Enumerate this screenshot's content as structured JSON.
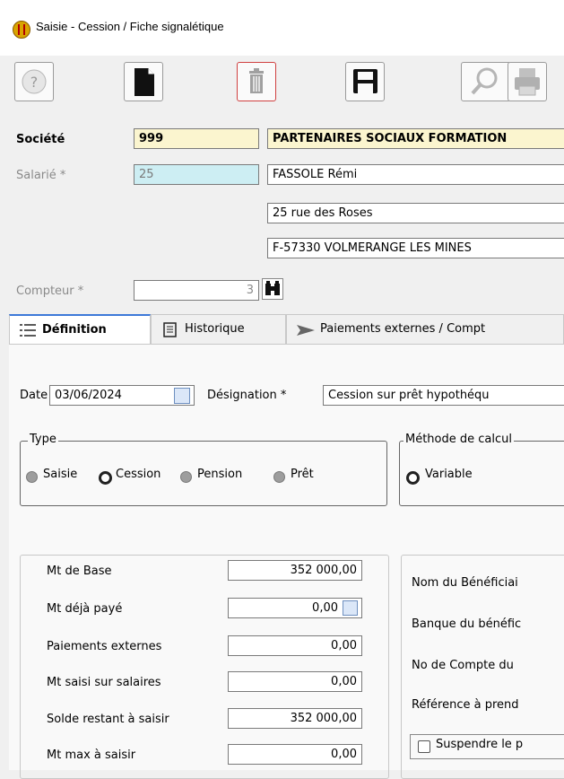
{
  "window": {
    "title": "Saisie - Cession / Fiche signalétique"
  },
  "header": {
    "societe_label": "Société",
    "societe_code": "999",
    "societe_name": "PARTENAIRES SOCIAUX FORMATION",
    "salarie_label": "Salarié *",
    "salarie_code": "25",
    "salarie_name": "FASSOLE Rémi",
    "address1": "25 rue des Roses",
    "address2": "F-57330 VOLMERANGE LES MINES",
    "compteur_label": "Compteur *",
    "compteur_value": "3"
  },
  "tabs": [
    {
      "label": "Définition"
    },
    {
      "label": "Historique"
    },
    {
      "label": "Paiements externes / Compt"
    }
  ],
  "definition": {
    "date_label": "Date",
    "date_value": "03/06/2024",
    "designation_label": "Désignation *",
    "designation_value": "Cession sur prêt hypothéqu",
    "type_legend": "Type",
    "type_options": [
      "Saisie",
      "Cession",
      "Pension",
      "Prêt"
    ],
    "type_selected": "Cession",
    "methode_legend": "Méthode de calcul",
    "methode_option": "Variable",
    "amounts": [
      {
        "label": "Mt de Base",
        "value": "352 000,00"
      },
      {
        "label": "Mt déjà payé",
        "value": "0,00"
      },
      {
        "label": "Paiements externes",
        "value": "0,00"
      },
      {
        "label": "Mt saisi sur salaires",
        "value": "0,00"
      },
      {
        "label": "Solde restant à saisir",
        "value": "352 000,00"
      },
      {
        "label": "Mt max à saisir",
        "value": "0,00"
      }
    ],
    "beneficiaire_labels": [
      "Nom du Bénéficiai",
      "Banque du bénéfic",
      "No de Compte du",
      "Référence à prend"
    ],
    "suspend_label": "Suspendre le p"
  }
}
